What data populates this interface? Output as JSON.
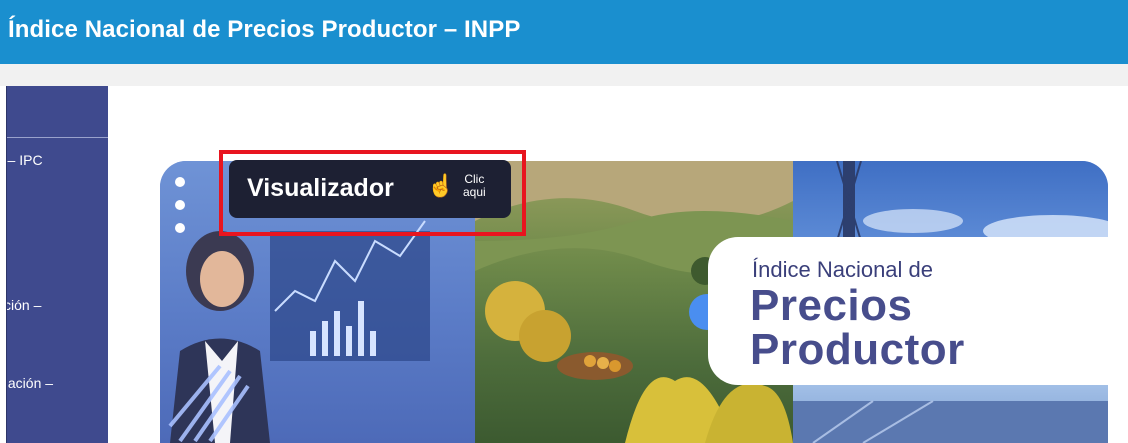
{
  "header": {
    "title": "Índice Nacional de Precios Productor – INPP",
    "background_color": "#1a8fcf"
  },
  "sidebar": {
    "background_color": "#3f4a8e",
    "items": [
      {
        "label": "r – IPC"
      },
      {
        "label": "cción –"
      },
      {
        "label": "diación –"
      }
    ]
  },
  "banner": {
    "visualizer_label": "Visualizador",
    "visualizer_icon": "hand-pointer-icon",
    "click_line1": "Clic",
    "click_line2": "aqui",
    "highlight_color": "#e8151f",
    "card_line1": "Índice Nacional de",
    "card_line2": "Precios",
    "card_line3": "Productor",
    "card_text_color": "#474d8c"
  }
}
